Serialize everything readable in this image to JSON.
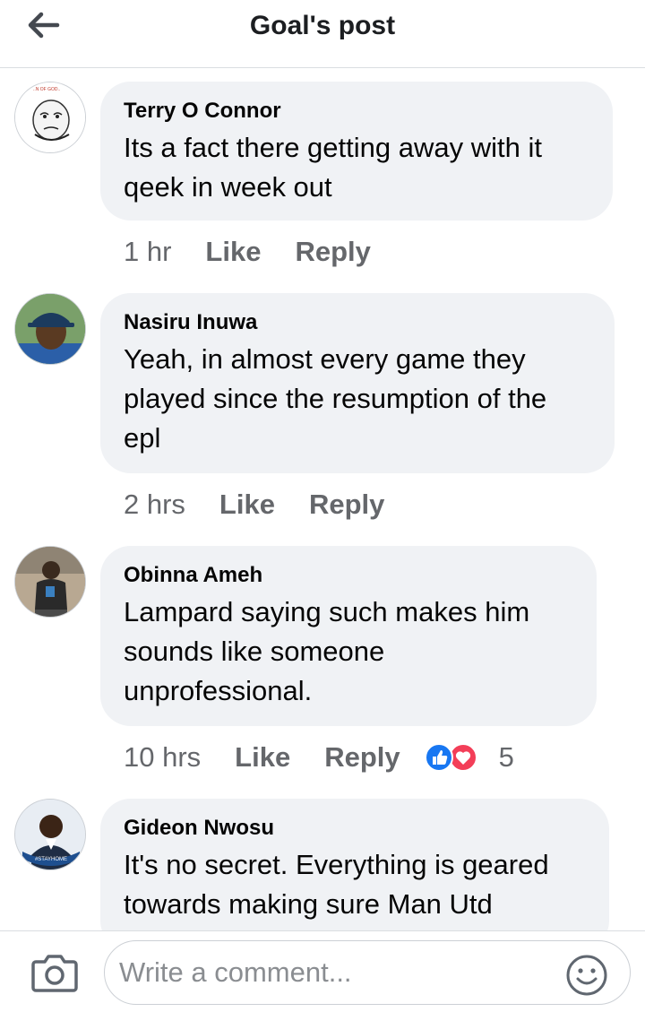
{
  "header": {
    "title": "Goal's post",
    "back_icon": "arrow-left-icon"
  },
  "comments": [
    {
      "author": "Terry O Connor",
      "text_lines": [
        "Its a fact there getting away with it",
        "qeek in week out"
      ],
      "time": "1 hr",
      "like": "Like",
      "reply": "Reply"
    },
    {
      "author": "Nasiru Inuwa",
      "text_lines": [
        "Yeah, in almost every game they",
        "played since the resumption of the",
        "epl"
      ],
      "time": "2 hrs",
      "like": "Like",
      "reply": "Reply"
    },
    {
      "author": "Obinna Ameh",
      "text_lines": [
        "Lampard saying such makes him",
        "sounds like someone",
        "unprofessional."
      ],
      "time": "10 hrs",
      "like": "Like",
      "reply": "Reply",
      "reactions": {
        "icons": [
          "like-reaction-icon",
          "love-reaction-icon"
        ],
        "count": "5"
      }
    },
    {
      "author": "Gideon Nwosu",
      "text_lines": [
        "It's no secret. Everything is geared",
        "towards making sure Man Utd"
      ],
      "avatar_badge": "#STAYHOME"
    }
  ],
  "composer": {
    "placeholder": "Write a comment...",
    "camera_icon": "camera-icon",
    "emoji_icon": "smiley-icon"
  },
  "colors": {
    "bubble": "#f0f2f5",
    "meta_text": "#65676b",
    "like_blue": "#1877f2",
    "love_red": "#f33e58"
  }
}
